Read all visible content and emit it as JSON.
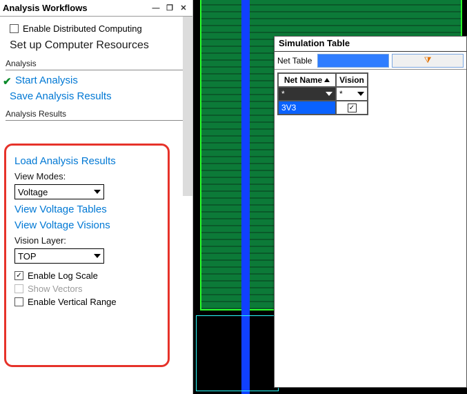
{
  "panel": {
    "title": "Analysis Workflows",
    "enable_distributed": "Enable Distributed Computing",
    "setup_resources": "Set up Computer Resources",
    "section_analysis": "Analysis",
    "start_analysis": "Start Analysis",
    "save_results": "Save Analysis Results",
    "section_results": "Analysis Results"
  },
  "results": {
    "load": "Load Analysis Results",
    "view_modes_label": "View Modes:",
    "view_mode_value": "Voltage",
    "view_tables": "View Voltage Tables",
    "view_visions": "View Voltage Visions",
    "vision_layer_label": "Vision Layer:",
    "vision_layer_value": "TOP",
    "enable_log": "Enable Log Scale",
    "show_vectors": "Show Vectors",
    "enable_vrange": "Enable Vertical Range"
  },
  "sim": {
    "title": "Simulation Table",
    "net_table_label": "Net Table",
    "col_net": "Net Name",
    "col_vision": "Vision",
    "filter_placeholder": "*",
    "rows": [
      {
        "net": "3V3",
        "vision": true
      }
    ]
  }
}
